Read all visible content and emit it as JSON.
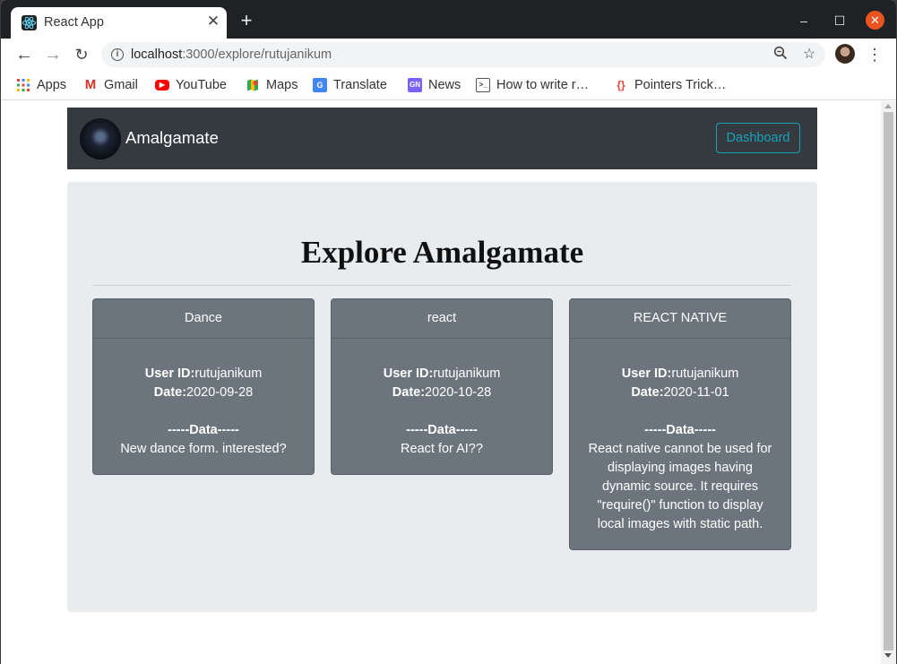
{
  "browser": {
    "tab": {
      "title": "React App"
    },
    "url": {
      "host": "localhost",
      "path": ":3000/explore/rutujanikum"
    },
    "bookmarks": [
      {
        "label": "Apps",
        "icon": "apps-grid-icon"
      },
      {
        "label": "Gmail",
        "icon": "gmail-icon"
      },
      {
        "label": "YouTube",
        "icon": "youtube-icon"
      },
      {
        "label": "Maps",
        "icon": "maps-icon"
      },
      {
        "label": "Translate",
        "icon": "translate-icon"
      },
      {
        "label": "News",
        "icon": "news-icon"
      },
      {
        "label": "How to write r…",
        "icon": "terminal-icon"
      },
      {
        "label": "Pointers Trick…",
        "icon": "code-braces-icon"
      }
    ]
  },
  "navbar": {
    "brand": "Amalgamate",
    "dashboard_button": "Dashboard"
  },
  "main": {
    "heading": "Explore Amalgamate",
    "labels": {
      "user_id": "User ID:",
      "date": "Date:",
      "data": "-----Data-----"
    },
    "cards": [
      {
        "title": "Dance",
        "user_id": "rutujanikum",
        "date": "2020-09-28",
        "data": "New dance form. interested?"
      },
      {
        "title": "react",
        "user_id": "rutujanikum",
        "date": "2020-10-28",
        "data": "React for AI??"
      },
      {
        "title": "REACT NATIVE",
        "user_id": "rutujanikum",
        "date": "2020-11-01",
        "data": "React native cannot be used for displaying images having dynamic source. It requires \"require()\" function to display local images with static path."
      }
    ]
  },
  "colors": {
    "navbar_bg": "#343a40",
    "accent_info": "#17a2b8",
    "card_bg": "#6c757d",
    "jumbotron_bg": "#e9ecef",
    "window_close": "#e95420"
  }
}
